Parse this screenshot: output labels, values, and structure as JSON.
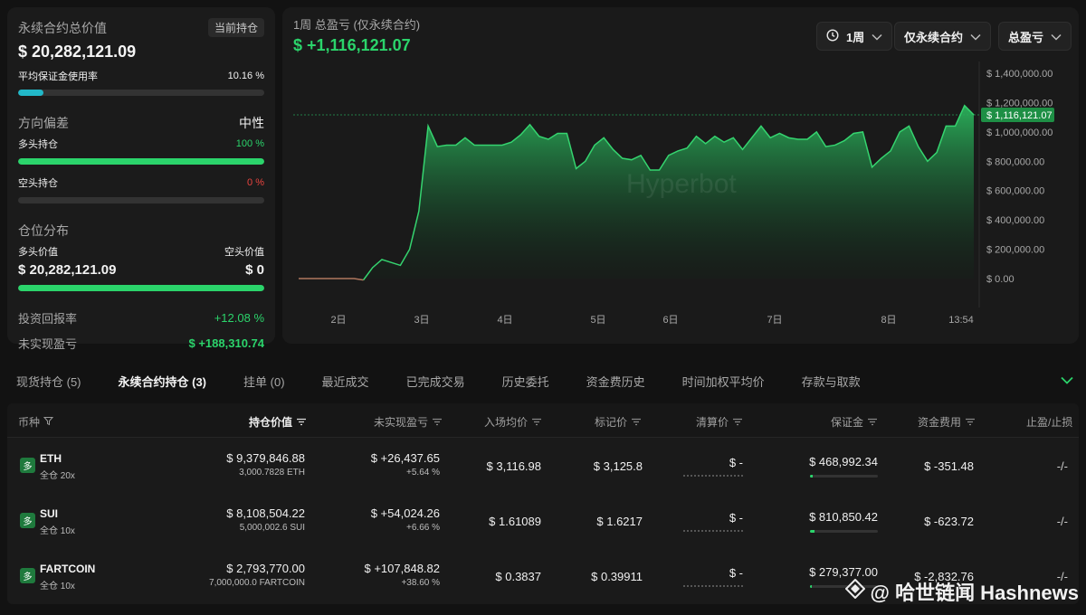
{
  "summary": {
    "total_value_label": "永续合约总价值",
    "current_positions_tab": "当前持仓",
    "total_value": "$ 20,282,121.09",
    "margin_usage_label": "平均保证金使用率",
    "margin_usage_value": "10.16 %",
    "margin_usage_fraction": 0.1016,
    "direction_bias_label": "方向偏差",
    "direction_bias_value": "中性",
    "long_label": "多头持仓",
    "long_pct": "100 %",
    "long_fraction": 1.0,
    "short_label": "空头持仓",
    "short_pct": "0 %",
    "short_fraction": 0.0,
    "distribution_label": "仓位分布",
    "long_value_label": "多头价值",
    "short_value_label": "空头价值",
    "long_value": "$ 20,282,121.09",
    "short_value": "$ 0",
    "long_value_fraction": 1.0,
    "roi_label": "投资回报率",
    "roi_value": "+12.08 %",
    "unrealized_label": "未实现盈亏",
    "unrealized_value": "$ +188,310.74"
  },
  "chart": {
    "title": "1周 总盈亏 (仅永续合约)",
    "pnl": "$ +1,116,121.07",
    "period_dropdown": "1周",
    "scope_dropdown": "仅永续合约",
    "metric_dropdown": "总盈亏",
    "current_marker": "$ 1,116,121.07",
    "watermark": "Hyperbot"
  },
  "chart_data": {
    "type": "area",
    "title": "1周 总盈亏 (仅永续合约)",
    "x_ticks": [
      "2日",
      "3日",
      "4日",
      "5日",
      "6日",
      "7日",
      "8日",
      "13:54"
    ],
    "y_ticks": [
      "$ 1,400,000.00",
      "$ 1,200,000.00",
      "$ 1,000,000.00",
      "$ 800,000.00",
      "$ 600,000.00",
      "$ 400,000.00",
      "$ 200,000.00",
      "$ 0.00"
    ],
    "ylim": [
      0,
      1400000
    ],
    "current_value": 1116121.07,
    "series": [
      {
        "values": [
          0,
          0,
          0,
          0,
          0,
          0,
          0,
          -10000,
          75000,
          130000,
          110000,
          90000,
          200000,
          460000,
          1040000,
          900000,
          910000,
          910000,
          960000,
          910000,
          910000,
          910000,
          910000,
          930000,
          980000,
          1050000,
          970000,
          950000,
          990000,
          990000,
          750000,
          800000,
          910000,
          960000,
          880000,
          820000,
          810000,
          840000,
          740000,
          740000,
          840000,
          870000,
          890000,
          970000,
          920000,
          970000,
          930000,
          960000,
          880000,
          960000,
          1040000,
          960000,
          990000,
          960000,
          950000,
          950000,
          1000000,
          900000,
          910000,
          940000,
          990000,
          1000000,
          760000,
          820000,
          870000,
          1000000,
          1040000,
          900000,
          800000,
          860000,
          1040000,
          1040000,
          1180000,
          1116121
        ]
      }
    ]
  },
  "tabs": [
    {
      "label": "现货持仓 (5)",
      "active": false
    },
    {
      "label": "永续合约持仓 (3)",
      "active": true
    },
    {
      "label": "挂单 (0)",
      "active": false
    },
    {
      "label": "最近成交",
      "active": false
    },
    {
      "label": "已完成交易",
      "active": false
    },
    {
      "label": "历史委托",
      "active": false
    },
    {
      "label": "资金费历史",
      "active": false
    },
    {
      "label": "时间加权平均价",
      "active": false
    },
    {
      "label": "存款与取款",
      "active": false
    }
  ],
  "table": {
    "headers": {
      "coin": "币种",
      "position_value": "持仓价值",
      "unrealized_pnl": "未实现盈亏",
      "entry_price": "入场均价",
      "mark_price": "标记价",
      "liq_price": "清算价",
      "margin": "保证金",
      "funding": "资金费用",
      "tpsl": "止盈/止损"
    },
    "rows": [
      {
        "badge": "多",
        "coin": "ETH",
        "leverage": "全仓 20x",
        "value": "$ 9,379,846.88",
        "size": "3,000.7828 ETH",
        "pnl": "$ +26,437.65",
        "pnl_pct": "+5.64 %",
        "entry": "$ 3,116.98",
        "mark": "$ 3,125.8",
        "liq": "$ -",
        "margin": "$ 468,992.34",
        "margin_fraction": 0.04,
        "funding": "$ -351.48",
        "tpsl": "-/-"
      },
      {
        "badge": "多",
        "coin": "SUI",
        "leverage": "全仓 10x",
        "value": "$ 8,108,504.22",
        "size": "5,000,002.6 SUI",
        "pnl": "$ +54,024.26",
        "pnl_pct": "+6.66 %",
        "entry": "$ 1.61089",
        "mark": "$ 1.6217",
        "liq": "$ -",
        "margin": "$ 810,850.42",
        "margin_fraction": 0.06,
        "funding": "$ -623.72",
        "tpsl": "-/-"
      },
      {
        "badge": "多",
        "coin": "FARTCOIN",
        "leverage": "全仓 10x",
        "value": "$ 2,793,770.00",
        "size": "7,000,000.0 FARTCOIN",
        "pnl": "$ +107,848.82",
        "pnl_pct": "+38.60 %",
        "entry": "$ 0.3837",
        "mark": "$ 0.39911",
        "liq": "$ -",
        "margin": "$ 279,377.00",
        "margin_fraction": 0.03,
        "funding": "$ -2,832.76",
        "tpsl": "-/-"
      }
    ]
  },
  "watermark": "@ 哈世链闻 Hashnews",
  "colors": {
    "accent_green": "#2bd46b",
    "negative_red": "#e9443f",
    "margin_teal": "#22b8c8"
  }
}
